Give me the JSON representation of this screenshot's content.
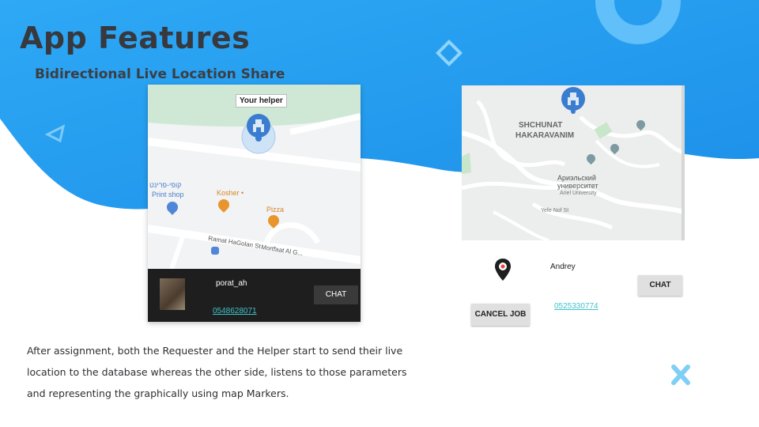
{
  "slide": {
    "title": "App Features",
    "subtitle": "Bidirectional Live Location Share",
    "description_lines": [
      "After assignment, both the Requester and the Helper start to send their live",
      "location to the database whereas the other side, listens to those parameters",
      "and representing the graphically using map Markers."
    ]
  },
  "left_screen": {
    "marker_tooltip": "Your helper",
    "map_labels": {
      "poi_hebrew": "קופי-פרינט",
      "print_shop": "Print shop",
      "kosher": "Kosher •",
      "pizza": "Pizza",
      "street1": "Ramat HaGolan St",
      "street2": "Mortfaat Al G..."
    },
    "user": {
      "name": "porat_ah",
      "phone": "0548628071"
    },
    "chat_label": "CHAT"
  },
  "right_screen": {
    "map_labels": {
      "district1": "SHCHUNAT",
      "district2": "HAKARAVANIM",
      "university_ru1": "Ариэльский",
      "university_ru2": "университет",
      "university_en": "Ariel University",
      "street": "Yefe Nof St"
    },
    "user": {
      "name": "Andrey",
      "phone": "0525330774"
    },
    "chat_label": "CHAT",
    "cancel_label": "CANCEL JOB"
  },
  "colors": {
    "wave_top": "#27a6f4",
    "wave_bottom": "#36b6fb",
    "link": "#3fc3c9",
    "accent_x": "#7fcef5"
  }
}
